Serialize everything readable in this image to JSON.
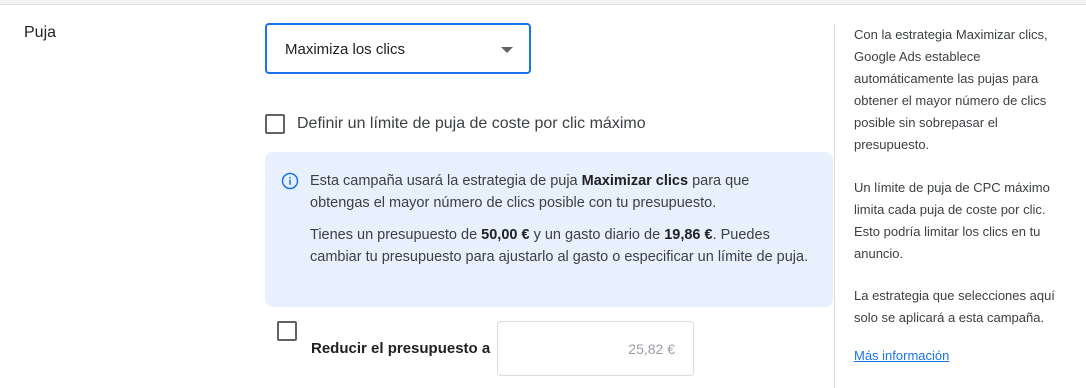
{
  "section": {
    "label": "Puja"
  },
  "strategy_select": {
    "value": "Maximiza los clics"
  },
  "max_cpc_checkbox": {
    "label": "Definir un límite de puja de coste por clic máximo",
    "checked": false
  },
  "info": {
    "p1_pre": "Esta campaña usará la estrategia de puja ",
    "p1_bold": "Maximizar clics",
    "p1_post": " para que obtengas el mayor número de clics posible con tu presupuesto.",
    "p2_pre": "Tienes un presupuesto de ",
    "p2_budget": "50,00 €",
    "p2_mid": " y un gasto diario de ",
    "p2_spend": "19,86 €",
    "p2_post": ". Puedes cambiar tu presupuesto para ajustarlo al gasto o especificar un límite de puja."
  },
  "reduce_budget": {
    "label": "Reducir el presupuesto a",
    "placeholder": "25,82 €",
    "checked": false
  },
  "sidebar": {
    "p1": "Con la estrategia Maximizar clics, Google Ads establece automáticamente las pujas para obtener el mayor número de clics posible sin sobrepasar el presupuesto.",
    "p2": "Un límite de puja de CPC máximo limita cada puja de coste por clic. Esto podría limitar los clics en tu anuncio.",
    "p3": "La estrategia que selecciones aquí solo se aplicará a esta campaña.",
    "link": "Más información"
  },
  "colors": {
    "accent": "#1a73e8",
    "info_bg": "#e8f0fe",
    "text": "#3c4043"
  },
  "icons": {
    "info": "info-icon",
    "dropdown": "chevron-down-icon"
  }
}
